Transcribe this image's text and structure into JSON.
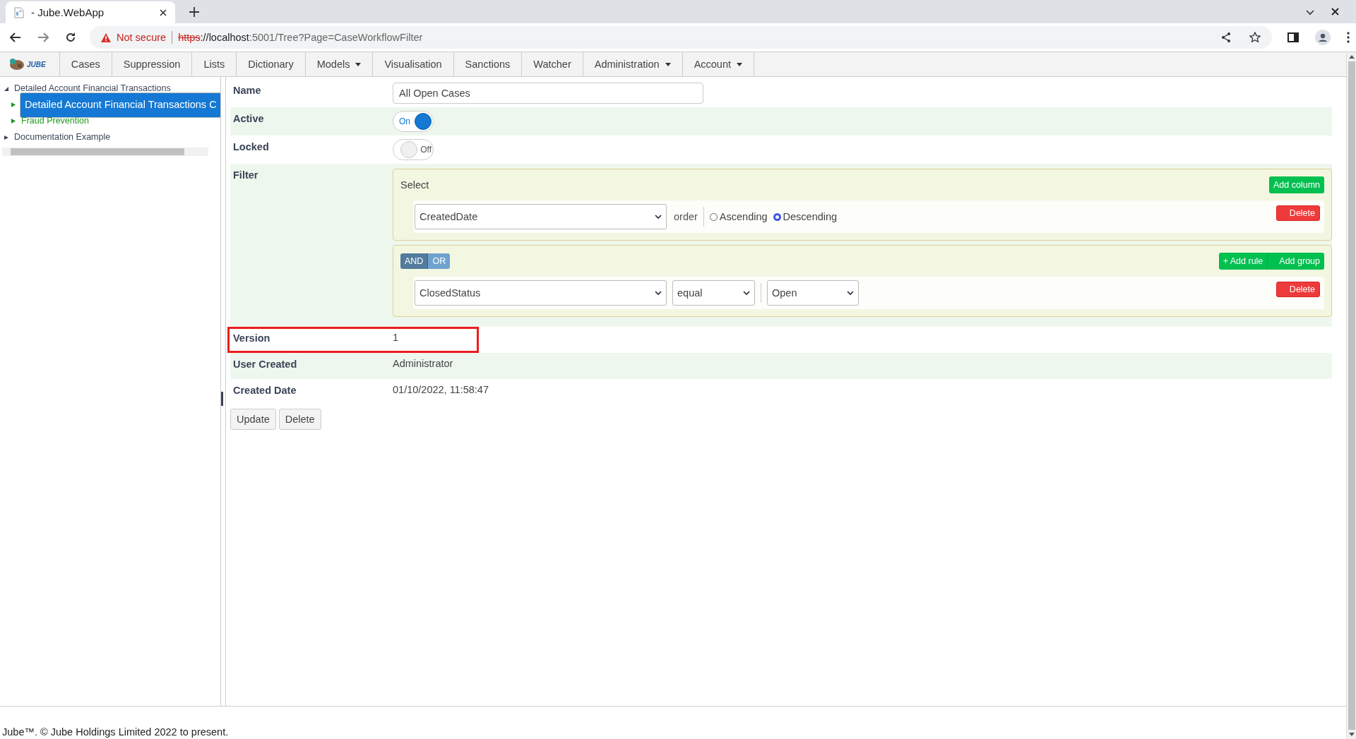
{
  "browser": {
    "tab_title": "- Jube.WebApp",
    "security": "Not secure",
    "url": {
      "scheme": "https",
      "host": "://localhost",
      "path": ":5001/Tree?Page=CaseWorkflowFilter"
    }
  },
  "nav": {
    "logo": "JUBE",
    "items": [
      {
        "label": "Cases",
        "dropdown": false
      },
      {
        "label": "Suppression",
        "dropdown": false
      },
      {
        "label": "Lists",
        "dropdown": false
      },
      {
        "label": "Dictionary",
        "dropdown": false
      },
      {
        "label": "Models",
        "dropdown": true
      },
      {
        "label": "Visualisation",
        "dropdown": false
      },
      {
        "label": "Sanctions",
        "dropdown": false
      },
      {
        "label": "Watcher",
        "dropdown": false
      },
      {
        "label": "Administration",
        "dropdown": true
      },
      {
        "label": "Account",
        "dropdown": true
      }
    ]
  },
  "tree": [
    {
      "label": "Detailed Account Financial Transactions",
      "expanded": true,
      "selected": false,
      "color": "#3c4858",
      "children": [
        {
          "label": "Detailed Account Financial Transactions C",
          "expanded": false,
          "selected": true,
          "color": "#1a9a1a"
        },
        {
          "label": "Fraud Prevention",
          "expanded": false,
          "selected": false,
          "color": "#1a9a1a"
        }
      ]
    },
    {
      "label": "Documentation Example",
      "expanded": false,
      "selected": false,
      "color": "#3c4858"
    }
  ],
  "form": {
    "name": {
      "label": "Name",
      "value": "All Open Cases"
    },
    "active": {
      "label": "Active",
      "on": true,
      "text": "On"
    },
    "locked": {
      "label": "Locked",
      "on": false,
      "text": "Off"
    },
    "filter": {
      "label": "Filter",
      "select": {
        "title": "Select",
        "add_button": "Add column",
        "column": "CreatedDate",
        "order_label": "order",
        "orders": [
          {
            "label": "Ascending",
            "selected": false
          },
          {
            "label": "Descending",
            "selected": true
          }
        ],
        "delete_button": "Delete"
      },
      "where": {
        "conditions": [
          {
            "label": "AND",
            "selected": true
          },
          {
            "label": "OR",
            "selected": false
          }
        ],
        "add_rule_button": "+ Add rule",
        "add_group_button": "Add group",
        "rule": {
          "field": "ClosedStatus",
          "operator": "equal",
          "value": "Open"
        },
        "delete_button": "Delete"
      }
    },
    "info": [
      {
        "label": "Version",
        "value": "1",
        "highlighted": true
      },
      {
        "label": "User Created",
        "value": "Administrator",
        "highlighted": false
      },
      {
        "label": "Created Date",
        "value": "01/10/2022, 11:58:47",
        "highlighted": false
      }
    ],
    "buttons": [
      "Update",
      "Delete"
    ]
  },
  "footer": "Jube™. © Jube Holdings Limited 2022 to present."
}
